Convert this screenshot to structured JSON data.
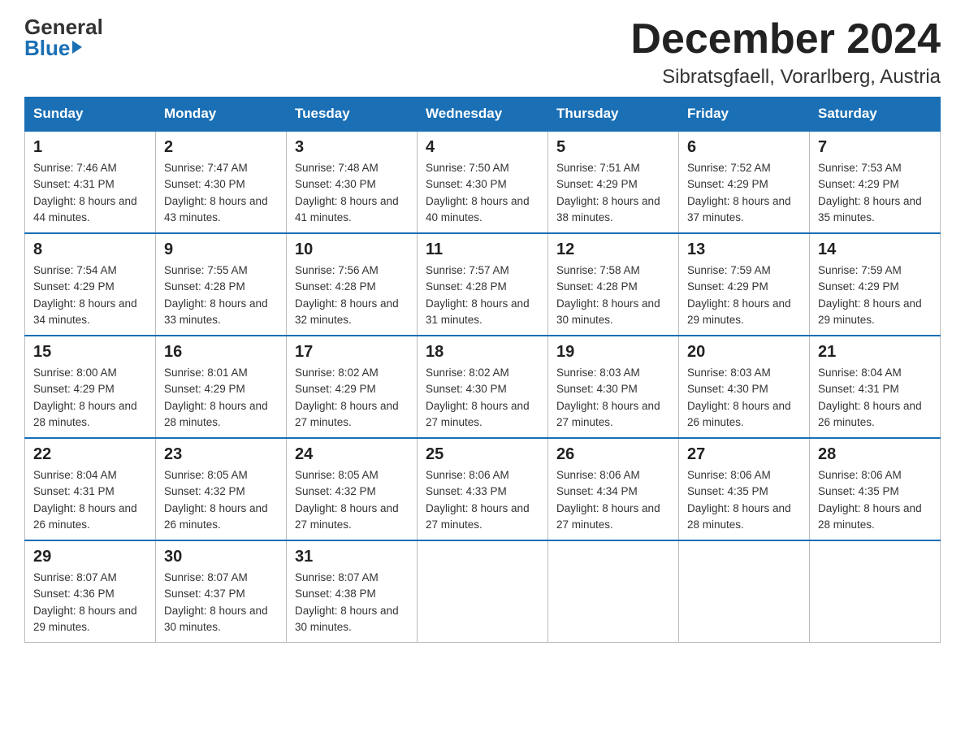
{
  "header": {
    "logo_general": "General",
    "logo_blue": "Blue",
    "title": "December 2024",
    "subtitle": "Sibratsgfaell, Vorarlberg, Austria"
  },
  "columns": [
    "Sunday",
    "Monday",
    "Tuesday",
    "Wednesday",
    "Thursday",
    "Friday",
    "Saturday"
  ],
  "weeks": [
    [
      {
        "day": "1",
        "sunrise": "Sunrise: 7:46 AM",
        "sunset": "Sunset: 4:31 PM",
        "daylight": "Daylight: 8 hours and 44 minutes."
      },
      {
        "day": "2",
        "sunrise": "Sunrise: 7:47 AM",
        "sunset": "Sunset: 4:30 PM",
        "daylight": "Daylight: 8 hours and 43 minutes."
      },
      {
        "day": "3",
        "sunrise": "Sunrise: 7:48 AM",
        "sunset": "Sunset: 4:30 PM",
        "daylight": "Daylight: 8 hours and 41 minutes."
      },
      {
        "day": "4",
        "sunrise": "Sunrise: 7:50 AM",
        "sunset": "Sunset: 4:30 PM",
        "daylight": "Daylight: 8 hours and 40 minutes."
      },
      {
        "day": "5",
        "sunrise": "Sunrise: 7:51 AM",
        "sunset": "Sunset: 4:29 PM",
        "daylight": "Daylight: 8 hours and 38 minutes."
      },
      {
        "day": "6",
        "sunrise": "Sunrise: 7:52 AM",
        "sunset": "Sunset: 4:29 PM",
        "daylight": "Daylight: 8 hours and 37 minutes."
      },
      {
        "day": "7",
        "sunrise": "Sunrise: 7:53 AM",
        "sunset": "Sunset: 4:29 PM",
        "daylight": "Daylight: 8 hours and 35 minutes."
      }
    ],
    [
      {
        "day": "8",
        "sunrise": "Sunrise: 7:54 AM",
        "sunset": "Sunset: 4:29 PM",
        "daylight": "Daylight: 8 hours and 34 minutes."
      },
      {
        "day": "9",
        "sunrise": "Sunrise: 7:55 AM",
        "sunset": "Sunset: 4:28 PM",
        "daylight": "Daylight: 8 hours and 33 minutes."
      },
      {
        "day": "10",
        "sunrise": "Sunrise: 7:56 AM",
        "sunset": "Sunset: 4:28 PM",
        "daylight": "Daylight: 8 hours and 32 minutes."
      },
      {
        "day": "11",
        "sunrise": "Sunrise: 7:57 AM",
        "sunset": "Sunset: 4:28 PM",
        "daylight": "Daylight: 8 hours and 31 minutes."
      },
      {
        "day": "12",
        "sunrise": "Sunrise: 7:58 AM",
        "sunset": "Sunset: 4:28 PM",
        "daylight": "Daylight: 8 hours and 30 minutes."
      },
      {
        "day": "13",
        "sunrise": "Sunrise: 7:59 AM",
        "sunset": "Sunset: 4:29 PM",
        "daylight": "Daylight: 8 hours and 29 minutes."
      },
      {
        "day": "14",
        "sunrise": "Sunrise: 7:59 AM",
        "sunset": "Sunset: 4:29 PM",
        "daylight": "Daylight: 8 hours and 29 minutes."
      }
    ],
    [
      {
        "day": "15",
        "sunrise": "Sunrise: 8:00 AM",
        "sunset": "Sunset: 4:29 PM",
        "daylight": "Daylight: 8 hours and 28 minutes."
      },
      {
        "day": "16",
        "sunrise": "Sunrise: 8:01 AM",
        "sunset": "Sunset: 4:29 PM",
        "daylight": "Daylight: 8 hours and 28 minutes."
      },
      {
        "day": "17",
        "sunrise": "Sunrise: 8:02 AM",
        "sunset": "Sunset: 4:29 PM",
        "daylight": "Daylight: 8 hours and 27 minutes."
      },
      {
        "day": "18",
        "sunrise": "Sunrise: 8:02 AM",
        "sunset": "Sunset: 4:30 PM",
        "daylight": "Daylight: 8 hours and 27 minutes."
      },
      {
        "day": "19",
        "sunrise": "Sunrise: 8:03 AM",
        "sunset": "Sunset: 4:30 PM",
        "daylight": "Daylight: 8 hours and 27 minutes."
      },
      {
        "day": "20",
        "sunrise": "Sunrise: 8:03 AM",
        "sunset": "Sunset: 4:30 PM",
        "daylight": "Daylight: 8 hours and 26 minutes."
      },
      {
        "day": "21",
        "sunrise": "Sunrise: 8:04 AM",
        "sunset": "Sunset: 4:31 PM",
        "daylight": "Daylight: 8 hours and 26 minutes."
      }
    ],
    [
      {
        "day": "22",
        "sunrise": "Sunrise: 8:04 AM",
        "sunset": "Sunset: 4:31 PM",
        "daylight": "Daylight: 8 hours and 26 minutes."
      },
      {
        "day": "23",
        "sunrise": "Sunrise: 8:05 AM",
        "sunset": "Sunset: 4:32 PM",
        "daylight": "Daylight: 8 hours and 26 minutes."
      },
      {
        "day": "24",
        "sunrise": "Sunrise: 8:05 AM",
        "sunset": "Sunset: 4:32 PM",
        "daylight": "Daylight: 8 hours and 27 minutes."
      },
      {
        "day": "25",
        "sunrise": "Sunrise: 8:06 AM",
        "sunset": "Sunset: 4:33 PM",
        "daylight": "Daylight: 8 hours and 27 minutes."
      },
      {
        "day": "26",
        "sunrise": "Sunrise: 8:06 AM",
        "sunset": "Sunset: 4:34 PM",
        "daylight": "Daylight: 8 hours and 27 minutes."
      },
      {
        "day": "27",
        "sunrise": "Sunrise: 8:06 AM",
        "sunset": "Sunset: 4:35 PM",
        "daylight": "Daylight: 8 hours and 28 minutes."
      },
      {
        "day": "28",
        "sunrise": "Sunrise: 8:06 AM",
        "sunset": "Sunset: 4:35 PM",
        "daylight": "Daylight: 8 hours and 28 minutes."
      }
    ],
    [
      {
        "day": "29",
        "sunrise": "Sunrise: 8:07 AM",
        "sunset": "Sunset: 4:36 PM",
        "daylight": "Daylight: 8 hours and 29 minutes."
      },
      {
        "day": "30",
        "sunrise": "Sunrise: 8:07 AM",
        "sunset": "Sunset: 4:37 PM",
        "daylight": "Daylight: 8 hours and 30 minutes."
      },
      {
        "day": "31",
        "sunrise": "Sunrise: 8:07 AM",
        "sunset": "Sunset: 4:38 PM",
        "daylight": "Daylight: 8 hours and 30 minutes."
      },
      null,
      null,
      null,
      null
    ]
  ]
}
